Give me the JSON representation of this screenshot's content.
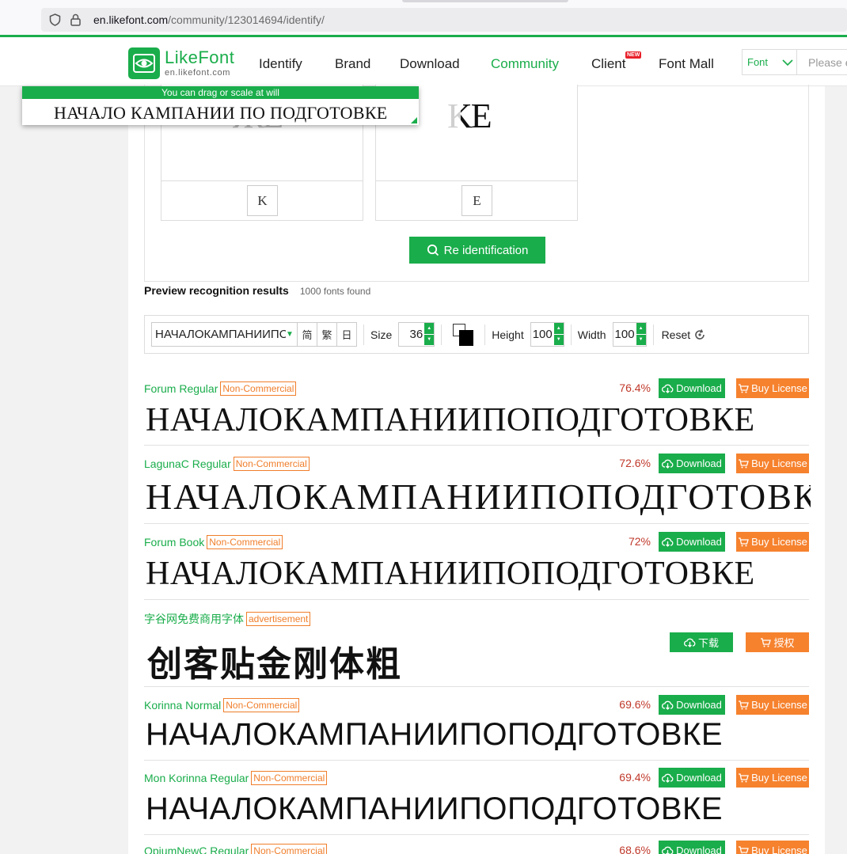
{
  "browser": {
    "url_domain": "en.likefont.com",
    "url_path": "/community/123014694/identify/"
  },
  "nav": {
    "logo_name": "LikeFont",
    "logo_sub": "en.likefont.com",
    "items": [
      "Identify",
      "Brand",
      "Download",
      "Community",
      "Client",
      "Font Mall"
    ],
    "active": "Community",
    "new_badge": "NEW",
    "search_select": "Font",
    "search_placeholder": "Please e"
  },
  "floating_preview": {
    "hint": "You can drag or scale at will",
    "text": "НАЧАЛО КАМПАНИИ ПО ПОДГОТОВКЕ"
  },
  "glyphs": [
    {
      "crop": "ЖЕ",
      "letter": "K"
    },
    {
      "crop": "KE",
      "letter": "E"
    }
  ],
  "reidentify_label": "Re identification",
  "preview": {
    "title": "Preview recognition results",
    "count": "1000 fonts found"
  },
  "toolbar": {
    "text": "НАЧАЛОКАМПАНИИПОПОД",
    "charset_buttons": [
      "简",
      "繁",
      "日"
    ],
    "size_label": "Size",
    "size_value": "36",
    "height_label": "Height",
    "height_value": "100",
    "width_label": "Width",
    "width_value": "100",
    "reset_label": "Reset"
  },
  "download_label": "Download",
  "buy_label": "Buy License",
  "results": [
    {
      "name": "Forum Regular",
      "tag": "Non-Commercial",
      "percent": "76.4%",
      "sample": "НАЧАЛОКАМПАНИИПОПОДГОТОВКЕ"
    },
    {
      "name": "LagunaC Regular",
      "tag": "Non-Commercial",
      "percent": "72.6%",
      "sample": "НАЧАЛОКАМПАНИИПОПОДГОТОВКЕ"
    },
    {
      "name": "Forum Book",
      "tag": "Non-Commercial",
      "percent": "72%",
      "sample": "НАЧАЛОКАМПАНИИПОПОДГОТОВКЕ"
    },
    {
      "name": "Korinna Normal",
      "tag": "Non-Commercial",
      "percent": "69.6%",
      "sample": "НАЧАЛОКАМПАНИИПОПОДГОТОВКЕ"
    },
    {
      "name": "Mon Korinna Regular",
      "tag": "Non-Commercial",
      "percent": "69.4%",
      "sample": "НАЧАЛОКАМПАНИИПОПОДГОТОВКЕ"
    },
    {
      "name": "OpiumNewC Regular",
      "tag": "Non-Commercial",
      "percent": "68.6%",
      "sample": ""
    }
  ],
  "ad": {
    "name": "字谷网免费商用字体",
    "tag": "advertisement",
    "sample": "创客贴金刚体粗",
    "download_label": "下载",
    "license_label": "授权"
  },
  "colors": {
    "brand_green": "#1aad4b",
    "license_orange": "#f6822e",
    "percent_red": "#c0392b"
  }
}
